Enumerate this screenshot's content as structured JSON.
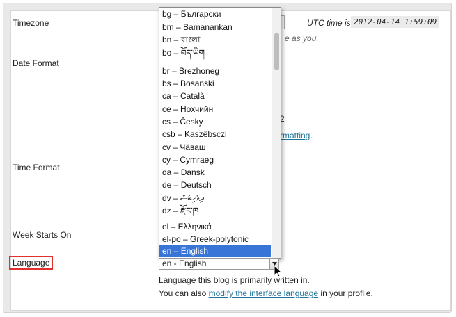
{
  "labels": {
    "timezone": "Timezone",
    "date_format": "Date Format",
    "time_format": "Time Format",
    "week_starts_on": "Week Starts On",
    "language": "Language"
  },
  "timezone": {
    "utc_label": "UTC time is",
    "utc_value": "2012-04-14 1:59:09",
    "hint_tail": "e as you."
  },
  "time_format": {
    "partial_value": "2",
    "link_fragment": "rmatting",
    "tail": "."
  },
  "language_dropdown": {
    "options": [
      "bg – Български",
      "bm – Bamanankan",
      "bn – বাংলা",
      "bo – བོད་ཡིག",
      "br – Brezhoneg",
      "bs – Bosanski",
      "ca – Català",
      "ce – Нохчийн",
      "cs – Česky",
      "csb – Kaszëbsczi",
      "cv – Чăваш",
      "cy – Cymraeg",
      "da – Dansk",
      "de – Deutsch",
      "dv – ދިވެހިބަސް",
      "dz – རྫོང་ཁ",
      "el – Ελληνικά",
      "el-po – Greek-polytonic",
      "en – English"
    ],
    "selected_index": 18,
    "selected_value": "en - English"
  },
  "language_help": {
    "line1": "Language this blog is primarily written in.",
    "line2_pre": "You can also",
    "line2_link": "modify the interface language",
    "line2_post": "in your profile."
  },
  "colors": {
    "selection": "#3875d7",
    "highlight_border": "#e0302f",
    "link": "#21759b"
  }
}
